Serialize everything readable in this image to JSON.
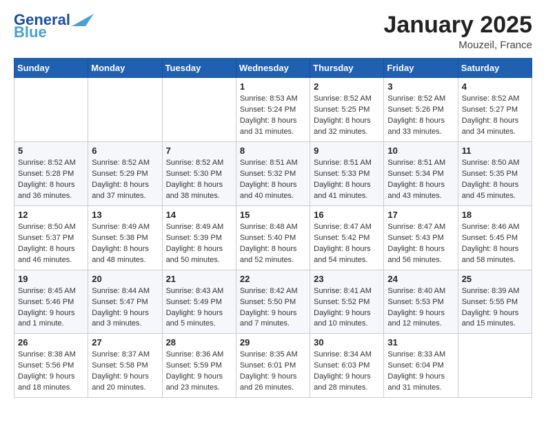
{
  "header": {
    "logo_line1": "General",
    "logo_line2": "Blue",
    "month": "January 2025",
    "location": "Mouzeil, France"
  },
  "weekdays": [
    "Sunday",
    "Monday",
    "Tuesday",
    "Wednesday",
    "Thursday",
    "Friday",
    "Saturday"
  ],
  "weeks": [
    [
      {
        "day": "",
        "info": ""
      },
      {
        "day": "",
        "info": ""
      },
      {
        "day": "",
        "info": ""
      },
      {
        "day": "1",
        "info": "Sunrise: 8:53 AM\nSunset: 5:24 PM\nDaylight: 8 hours\nand 31 minutes."
      },
      {
        "day": "2",
        "info": "Sunrise: 8:52 AM\nSunset: 5:25 PM\nDaylight: 8 hours\nand 32 minutes."
      },
      {
        "day": "3",
        "info": "Sunrise: 8:52 AM\nSunset: 5:26 PM\nDaylight: 8 hours\nand 33 minutes."
      },
      {
        "day": "4",
        "info": "Sunrise: 8:52 AM\nSunset: 5:27 PM\nDaylight: 8 hours\nand 34 minutes."
      }
    ],
    [
      {
        "day": "5",
        "info": "Sunrise: 8:52 AM\nSunset: 5:28 PM\nDaylight: 8 hours\nand 36 minutes."
      },
      {
        "day": "6",
        "info": "Sunrise: 8:52 AM\nSunset: 5:29 PM\nDaylight: 8 hours\nand 37 minutes."
      },
      {
        "day": "7",
        "info": "Sunrise: 8:52 AM\nSunset: 5:30 PM\nDaylight: 8 hours\nand 38 minutes."
      },
      {
        "day": "8",
        "info": "Sunrise: 8:51 AM\nSunset: 5:32 PM\nDaylight: 8 hours\nand 40 minutes."
      },
      {
        "day": "9",
        "info": "Sunrise: 8:51 AM\nSunset: 5:33 PM\nDaylight: 8 hours\nand 41 minutes."
      },
      {
        "day": "10",
        "info": "Sunrise: 8:51 AM\nSunset: 5:34 PM\nDaylight: 8 hours\nand 43 minutes."
      },
      {
        "day": "11",
        "info": "Sunrise: 8:50 AM\nSunset: 5:35 PM\nDaylight: 8 hours\nand 45 minutes."
      }
    ],
    [
      {
        "day": "12",
        "info": "Sunrise: 8:50 AM\nSunset: 5:37 PM\nDaylight: 8 hours\nand 46 minutes."
      },
      {
        "day": "13",
        "info": "Sunrise: 8:49 AM\nSunset: 5:38 PM\nDaylight: 8 hours\nand 48 minutes."
      },
      {
        "day": "14",
        "info": "Sunrise: 8:49 AM\nSunset: 5:39 PM\nDaylight: 8 hours\nand 50 minutes."
      },
      {
        "day": "15",
        "info": "Sunrise: 8:48 AM\nSunset: 5:40 PM\nDaylight: 8 hours\nand 52 minutes."
      },
      {
        "day": "16",
        "info": "Sunrise: 8:47 AM\nSunset: 5:42 PM\nDaylight: 8 hours\nand 54 minutes."
      },
      {
        "day": "17",
        "info": "Sunrise: 8:47 AM\nSunset: 5:43 PM\nDaylight: 8 hours\nand 56 minutes."
      },
      {
        "day": "18",
        "info": "Sunrise: 8:46 AM\nSunset: 5:45 PM\nDaylight: 8 hours\nand 58 minutes."
      }
    ],
    [
      {
        "day": "19",
        "info": "Sunrise: 8:45 AM\nSunset: 5:46 PM\nDaylight: 9 hours\nand 1 minute."
      },
      {
        "day": "20",
        "info": "Sunrise: 8:44 AM\nSunset: 5:47 PM\nDaylight: 9 hours\nand 3 minutes."
      },
      {
        "day": "21",
        "info": "Sunrise: 8:43 AM\nSunset: 5:49 PM\nDaylight: 9 hours\nand 5 minutes."
      },
      {
        "day": "22",
        "info": "Sunrise: 8:42 AM\nSunset: 5:50 PM\nDaylight: 9 hours\nand 7 minutes."
      },
      {
        "day": "23",
        "info": "Sunrise: 8:41 AM\nSunset: 5:52 PM\nDaylight: 9 hours\nand 10 minutes."
      },
      {
        "day": "24",
        "info": "Sunrise: 8:40 AM\nSunset: 5:53 PM\nDaylight: 9 hours\nand 12 minutes."
      },
      {
        "day": "25",
        "info": "Sunrise: 8:39 AM\nSunset: 5:55 PM\nDaylight: 9 hours\nand 15 minutes."
      }
    ],
    [
      {
        "day": "26",
        "info": "Sunrise: 8:38 AM\nSunset: 5:56 PM\nDaylight: 9 hours\nand 18 minutes."
      },
      {
        "day": "27",
        "info": "Sunrise: 8:37 AM\nSunset: 5:58 PM\nDaylight: 9 hours\nand 20 minutes."
      },
      {
        "day": "28",
        "info": "Sunrise: 8:36 AM\nSunset: 5:59 PM\nDaylight: 9 hours\nand 23 minutes."
      },
      {
        "day": "29",
        "info": "Sunrise: 8:35 AM\nSunset: 6:01 PM\nDaylight: 9 hours\nand 26 minutes."
      },
      {
        "day": "30",
        "info": "Sunrise: 8:34 AM\nSunset: 6:03 PM\nDaylight: 9 hours\nand 28 minutes."
      },
      {
        "day": "31",
        "info": "Sunrise: 8:33 AM\nSunset: 6:04 PM\nDaylight: 9 hours\nand 31 minutes."
      },
      {
        "day": "",
        "info": ""
      }
    ]
  ]
}
